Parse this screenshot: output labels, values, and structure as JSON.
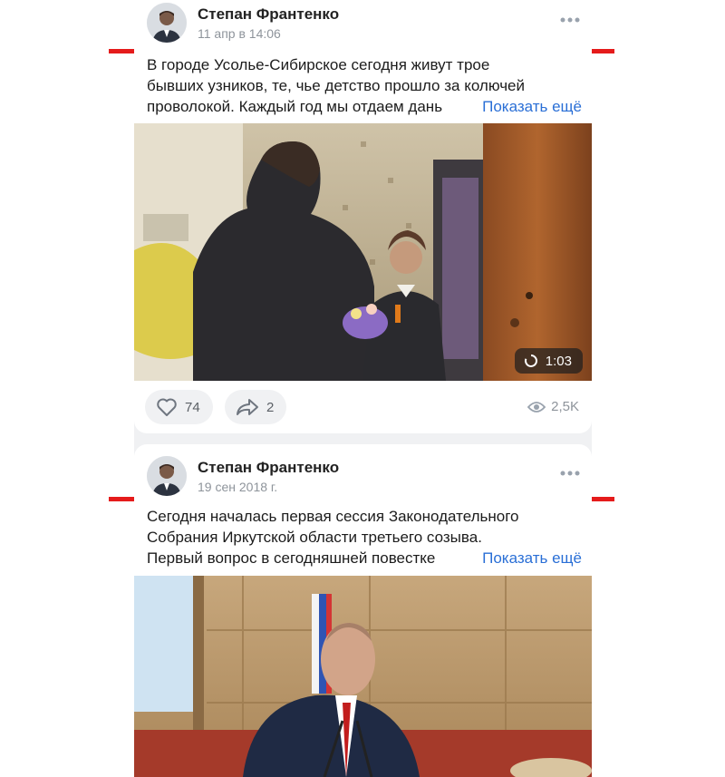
{
  "posts": [
    {
      "author": "Степан Франтенко",
      "date": "11 апр в 14:06",
      "text_lines": [
        "В городе Усолье-Сибирское сегодня живут трое",
        "бывших узников, те, чье детство прошло за колючей",
        "проволокой. Каждый год мы отдаем дань"
      ],
      "show_more": "Показать ещё",
      "video_duration": "1:03",
      "likes": "74",
      "shares": "2",
      "views": "2,5K"
    },
    {
      "author": "Степан Франтенко",
      "date": "19 сен 2018 г.",
      "text_lines": [
        "Сегодня началась первая сессия Законодательного",
        "Собрания Иркутской области третьего созыва.",
        "Первый вопрос в сегодняшней повестке"
      ],
      "show_more": "Показать ещё"
    }
  ],
  "colors": {
    "accent_link": "#2a6fd6",
    "highlight_line": "#e51b1b",
    "feed_background": "#f0f1f3"
  },
  "icons": [
    "more-dots-icon",
    "heart-icon",
    "share-icon",
    "eye-icon",
    "replay-icon"
  ]
}
